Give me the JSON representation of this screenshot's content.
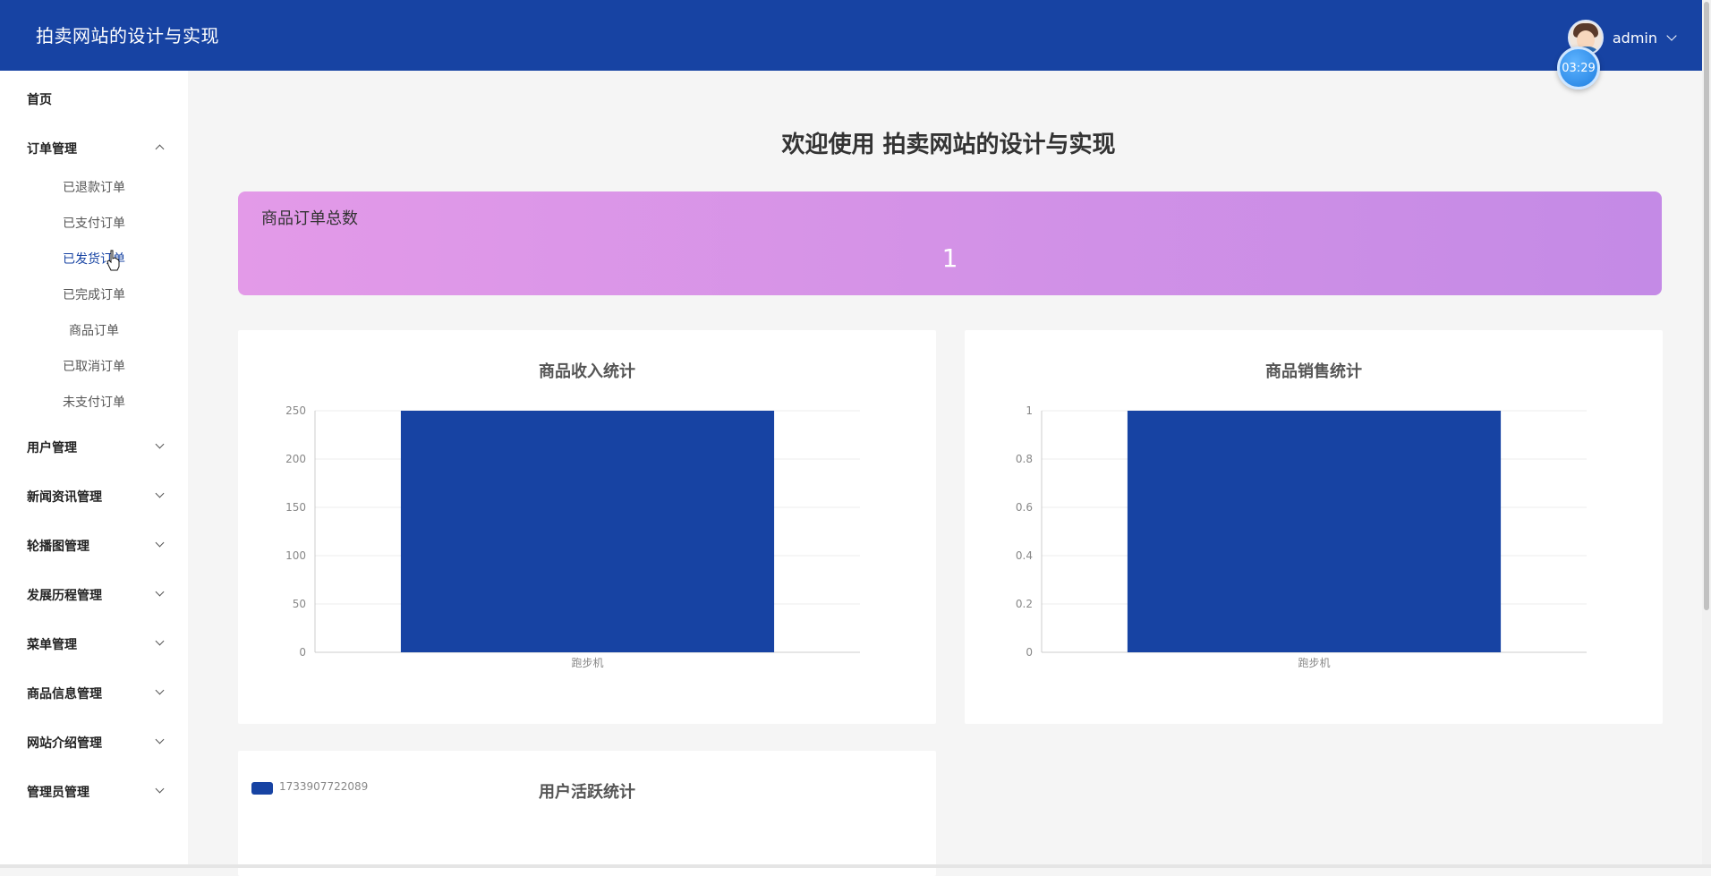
{
  "header": {
    "site_title": "拍卖网站的设计与实现",
    "user_name": "admin",
    "timer": "03:29",
    "bg_color": "#1743a3"
  },
  "sidebar": {
    "home": "首页",
    "groups": [
      {
        "label": "订单管理",
        "expanded": true
      },
      {
        "label": "用户管理",
        "expanded": false
      },
      {
        "label": "新闻资讯管理",
        "expanded": false
      },
      {
        "label": "轮播图管理",
        "expanded": false
      },
      {
        "label": "发展历程管理",
        "expanded": false
      },
      {
        "label": "菜单管理",
        "expanded": false
      },
      {
        "label": "商品信息管理",
        "expanded": false
      },
      {
        "label": "网站介绍管理",
        "expanded": false
      },
      {
        "label": "管理员管理",
        "expanded": false
      }
    ],
    "order_sub_items": [
      "已退款订单",
      "已支付订单",
      "已发货订单",
      "已完成订单",
      "商品订单",
      "已取消订单",
      "未支付订单"
    ],
    "active_sub_item": "已发货订单"
  },
  "main": {
    "welcome": "欢迎使用 拍卖网站的设计与实现",
    "orders_card": {
      "label": "商品订单总数",
      "value": "1"
    }
  },
  "chart_data": [
    {
      "type": "bar",
      "title": "商品收入统计",
      "categories": [
        "跑步机"
      ],
      "values": [
        250
      ],
      "ylim": [
        0,
        250
      ],
      "yticks": [
        "0",
        "50",
        "100",
        "150",
        "200",
        "250"
      ],
      "grid": true,
      "color": "#1743a3"
    },
    {
      "type": "bar",
      "title": "商品销售统计",
      "categories": [
        "跑步机"
      ],
      "values": [
        1
      ],
      "ylim": [
        0,
        1
      ],
      "yticks": [
        "0",
        "0.2",
        "0.4",
        "0.6",
        "0.8",
        "1"
      ],
      "grid": true,
      "color": "#1743a3"
    },
    {
      "type": "bar",
      "title": "用户活跃统计",
      "legend": [
        "1733907722089"
      ],
      "legend_position": "top-left",
      "color": "#1743a3"
    }
  ]
}
